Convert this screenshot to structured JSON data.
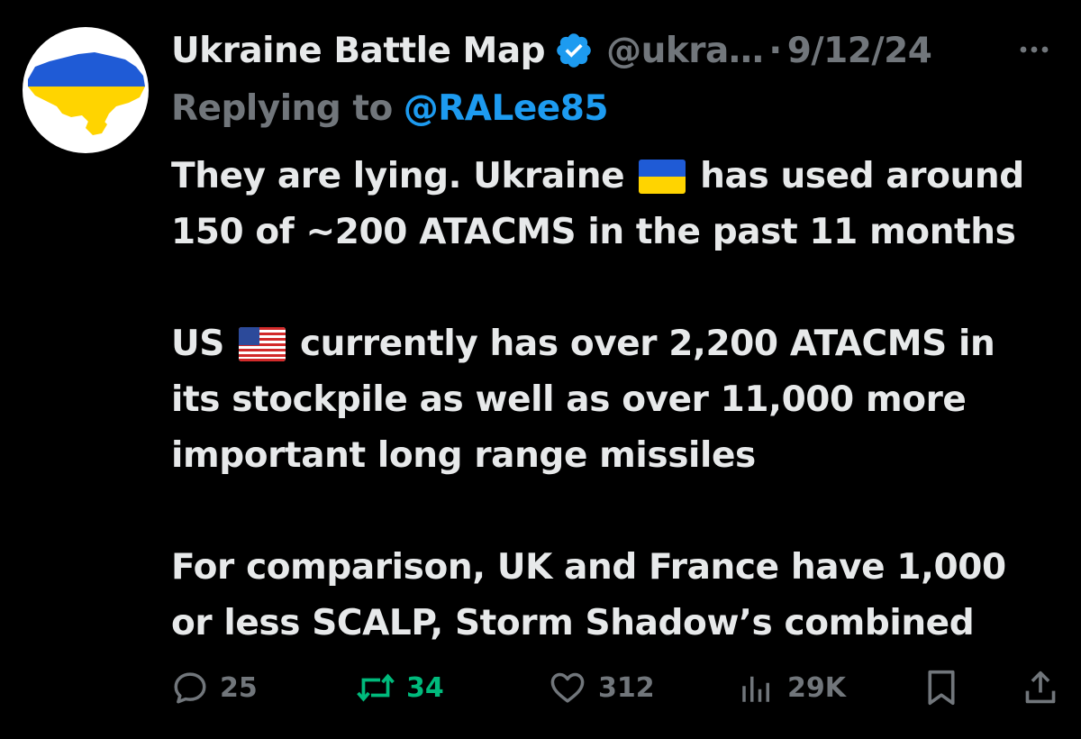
{
  "author": {
    "display_name": "Ukraine Battle Map",
    "handle": "@ukra…",
    "separator": "·",
    "date": "9/12/24",
    "verified": true,
    "avatar_colors": {
      "background": "#ffffff",
      "blue": "#1f5bd6",
      "yellow": "#ffd400"
    }
  },
  "reply": {
    "label": "Replying to",
    "handle": "@RALee85"
  },
  "tweet": {
    "line1_a": "They are lying. Ukraine",
    "line1_b": "has used around",
    "line2": "150 of ~200 ATACMS in the past 11 months",
    "line3_a": "US",
    "line3_b": "currently has over 2,200 ATACMS in",
    "line4": "its stockpile as well as over 11,000 more",
    "line5": "important long range missiles",
    "line6": "For comparison, UK and France have 1,000",
    "line7": "or less SCALP, Storm Shadow’s combined"
  },
  "icons": {
    "flag_ukraine": "flag-ukraine-icon",
    "flag_us": "flag-us-icon",
    "verified": "verified-badge-icon",
    "more": "more-icon"
  },
  "actions": {
    "replies": "25",
    "reposts": "34",
    "likes": "312",
    "views": "29K"
  },
  "colors": {
    "background": "#000000",
    "text": "#e7e9ea",
    "muted": "#71767b",
    "link": "#1d9bf0",
    "repost": "#00ba7c"
  }
}
